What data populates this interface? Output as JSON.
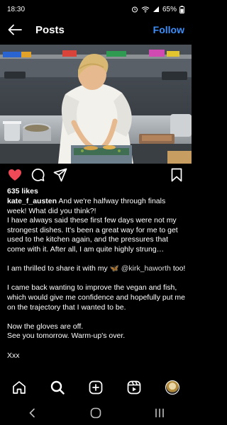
{
  "status_bar": {
    "time": "18:30",
    "battery": "65%"
  },
  "header": {
    "title": "Posts",
    "follow_label": "Follow"
  },
  "post": {
    "likes": "635 likes",
    "username": "kate_f_austen",
    "caption_first": " And we're halfway through finals week! What did you think?!",
    "caption_p2": "I have always said these first few days were not my strongest dishes. It's been a great way for me to get used to the kitchen again, and the pressures that come with it. After all, I am quite highly strung…",
    "caption_p3_before": "I am thrilled to share it with my 🦋 ",
    "caption_mention": "@kirk_haworth",
    "caption_p3_after": " too!",
    "caption_p4": "I came back wanting to improve the vegan and fish, which would give me confidence and hopefully put me on the trajectory that I wanted to be.",
    "caption_p5_line1": "Now the gloves are off.",
    "caption_p5_line2": "See you tomorrow. Warm-up's over.",
    "caption_p6": "Xxx"
  },
  "icons": {
    "back": "arrow-left-icon",
    "like": "heart-icon",
    "comment": "comment-bubble-icon",
    "share": "paper-plane-icon",
    "save": "bookmark-icon",
    "home": "home-icon",
    "search": "search-icon",
    "create": "plus-square-icon",
    "reels": "reels-icon",
    "profile": "profile-avatar"
  },
  "colors": {
    "accent": "#3d8ef7",
    "like": "#ed4956",
    "background": "#000000"
  }
}
